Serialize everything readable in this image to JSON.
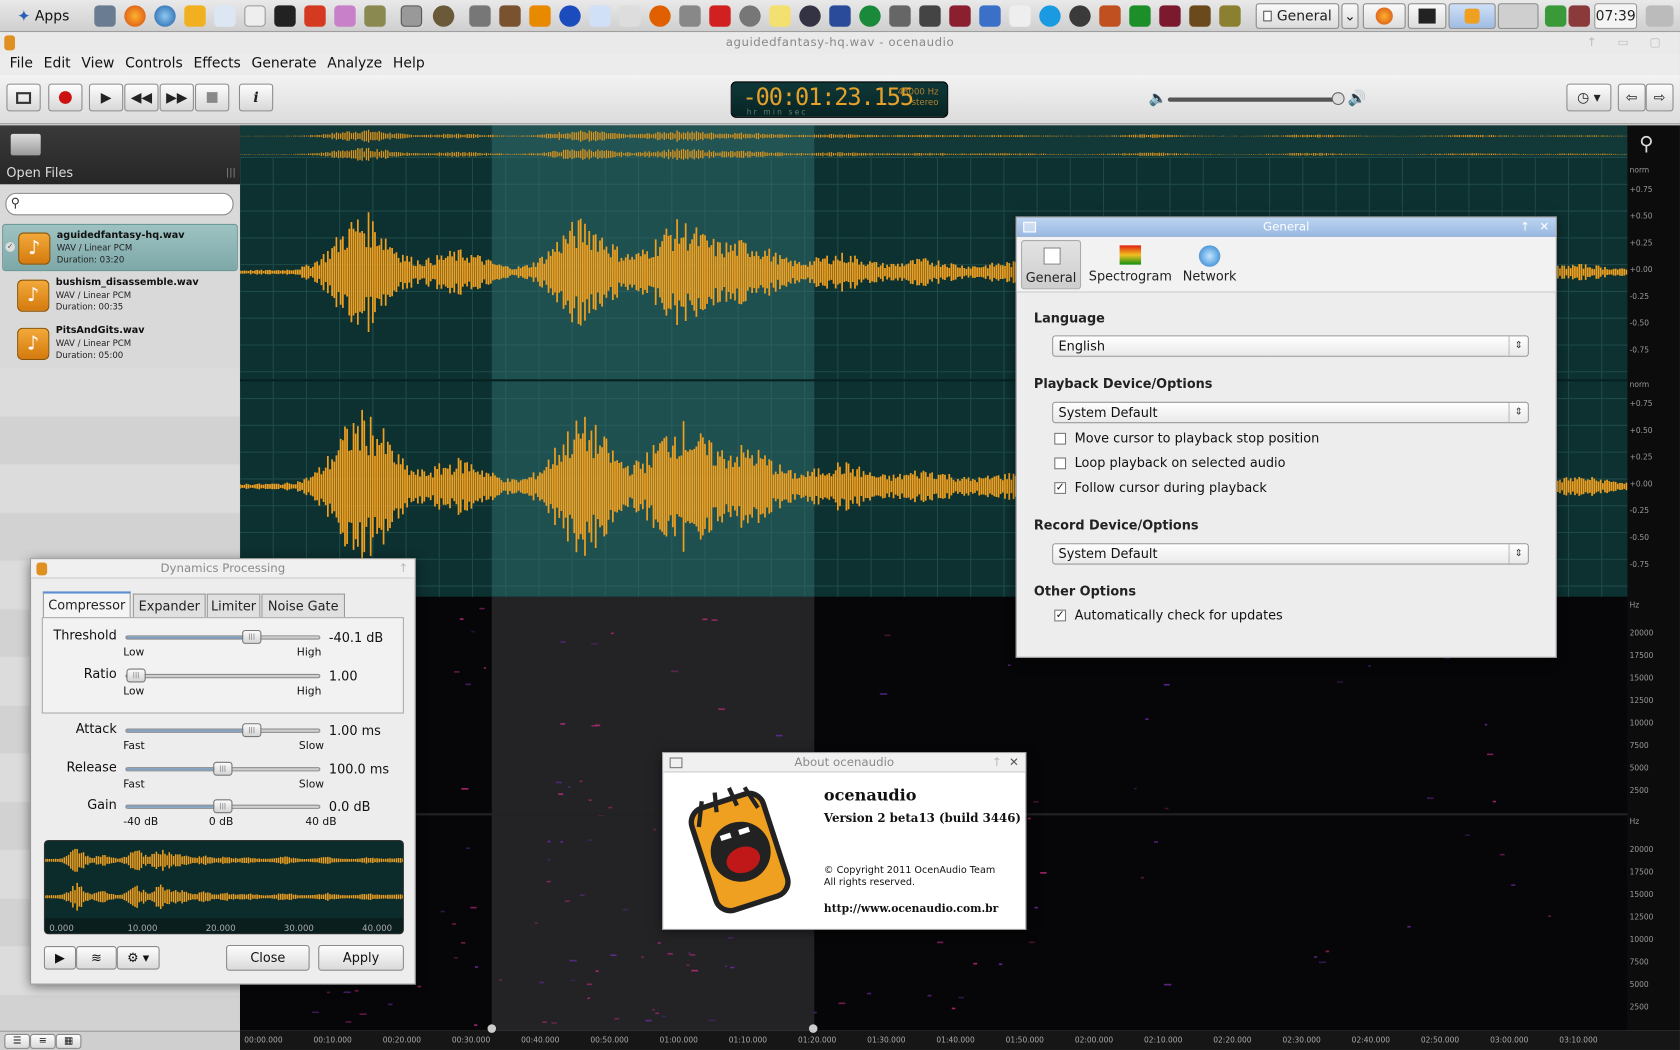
{
  "taskbar": {
    "apps_label": "Apps",
    "task_general": "General",
    "clock": "07:39"
  },
  "window": {
    "title": "aguidedfantasy-hq.wav - ocenaudio"
  },
  "menubar": [
    "File",
    "Edit",
    "View",
    "Controls",
    "Effects",
    "Generate",
    "Analyze",
    "Help"
  ],
  "display": {
    "time": "-00:01:23.155",
    "sample_rate": "48000 Hz",
    "channels": "stereo",
    "units": "hr  min sec"
  },
  "sidebar": {
    "title": "Open Files",
    "search_placeholder": "",
    "files": [
      {
        "name": "aguidedfantasy-hq.wav",
        "format": "WAV / Linear PCM",
        "duration": "Duration: 03:20",
        "selected": true
      },
      {
        "name": "bushism_disassemble.wav",
        "format": "WAV / Linear PCM",
        "duration": "Duration: 00:35",
        "selected": false
      },
      {
        "name": "PitsAndGits.wav",
        "format": "WAV / Linear PCM",
        "duration": "Duration: 05:00",
        "selected": false
      }
    ]
  },
  "ruler": {
    "norm_label": "norm",
    "amp_ticks": [
      "+0.75",
      "+0.50",
      "+0.25",
      "+0.00",
      "-0.25",
      "-0.50",
      "-0.75"
    ],
    "hz_label": "Hz",
    "hz_ticks": [
      "20000",
      "17500",
      "15000",
      "12500",
      "10000",
      "7500",
      "5000",
      "2500"
    ],
    "time_ticks": [
      "00:00.000",
      "00:10.000",
      "00:20.000",
      "00:30.000",
      "00:40.000",
      "00:50.000",
      "01:00.000",
      "01:10.000",
      "01:20.000",
      "01:30.000",
      "01:40.000",
      "01:50.000",
      "02:00.000",
      "02:10.000",
      "02:20.000",
      "02:30.000",
      "02:40.000",
      "02:50.000",
      "03:00.000",
      "03:10.000"
    ]
  },
  "dynamics": {
    "title": "Dynamics Processing",
    "tabs": [
      "Compressor",
      "Expander",
      "Limiter",
      "Noise Gate"
    ],
    "threshold": {
      "label": "Threshold",
      "low": "Low",
      "high": "High",
      "value": "-40.1 dB",
      "level": 0.65
    },
    "ratio": {
      "label": "Ratio",
      "low": "Low",
      "high": "High",
      "value": "1.00",
      "level": 0.05
    },
    "attack": {
      "label": "Attack",
      "low": "Fast",
      "high": "Slow",
      "value": "1.00 ms",
      "level": 0.65
    },
    "release": {
      "label": "Release",
      "low": "Fast",
      "high": "Slow",
      "value": "100.0 ms",
      "level": 0.5
    },
    "gain": {
      "label": "Gain",
      "low": "-40 dB",
      "mid": "0 dB",
      "high": "40 dB",
      "value": "0.0 dB",
      "level": 0.5
    },
    "preview_ticks": [
      "0.000",
      "10.000",
      "20.000",
      "30.000",
      "40.000"
    ],
    "close_label": "Close",
    "apply_label": "Apply"
  },
  "about": {
    "title": "About ocenaudio",
    "app_name": "ocenaudio",
    "version": "Version 2 beta13 (build 3446)",
    "copyright": "© Copyright 2011 OcenAudio Team",
    "rights": "All rights reserved.",
    "url": "http://www.ocenaudio.com.br"
  },
  "general": {
    "title": "General",
    "tabs": [
      "General",
      "Spectrogram",
      "Network"
    ],
    "language_label": "Language",
    "language_value": "English",
    "playback_label": "Playback Device/Options",
    "playback_value": "System Default",
    "opt_move": "Move cursor to playback stop position",
    "opt_loop": "Loop playback on selected audio",
    "opt_follow": "Follow cursor during playback",
    "record_label": "Record Device/Options",
    "record_value": "System Default",
    "other_label": "Other Options",
    "opt_updates": "Automatically check for updates",
    "checks": {
      "move": false,
      "loop": false,
      "follow": true,
      "updates": true
    }
  },
  "colors": {
    "wave": "#f0a020",
    "accent": "#5b8ed0",
    "selection": "#2f6b6b"
  }
}
